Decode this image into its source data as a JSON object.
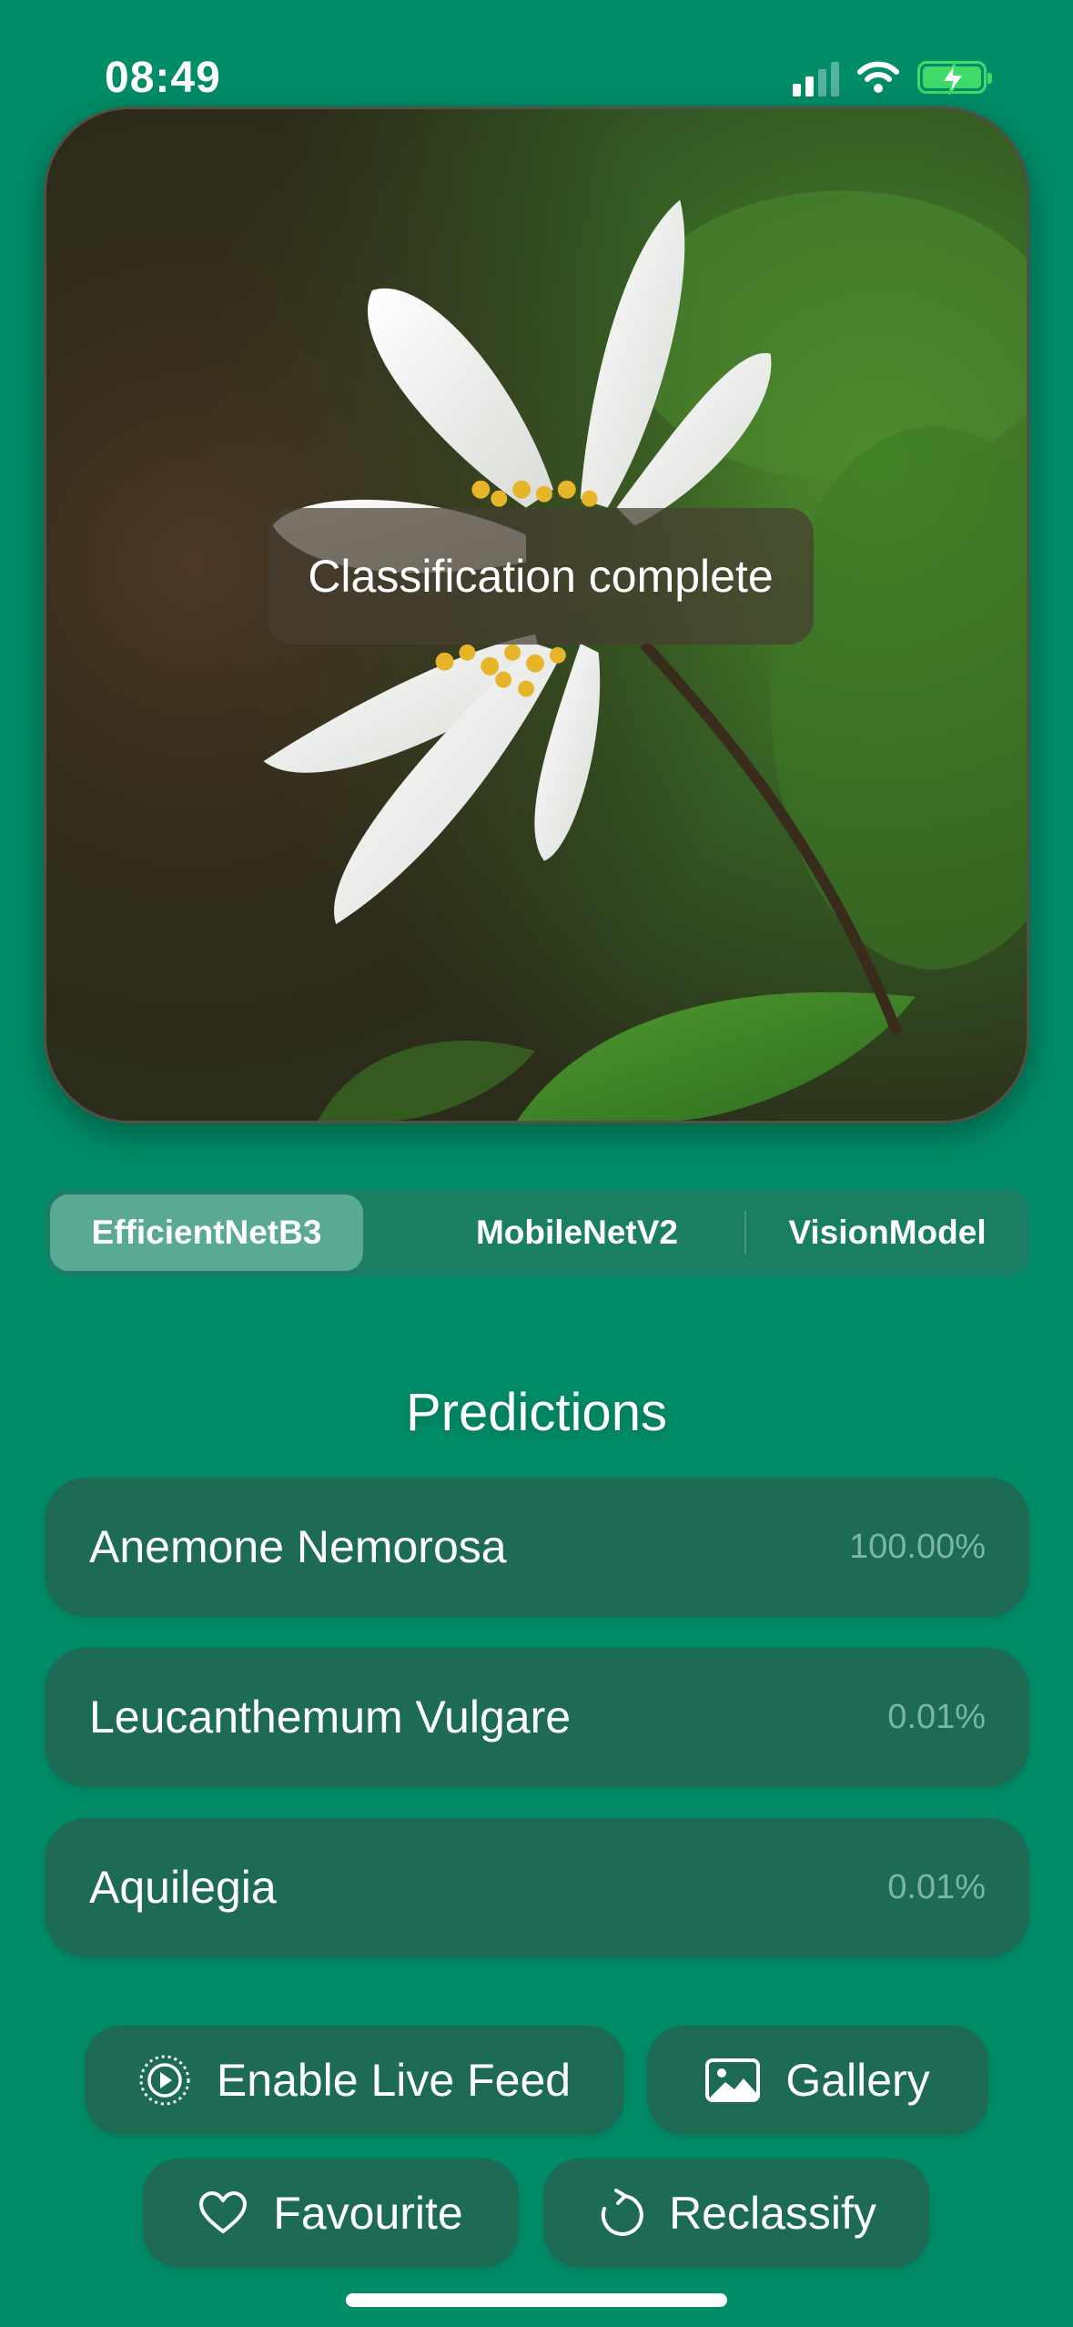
{
  "status_bar": {
    "time": "08:49"
  },
  "photo": {
    "toast": "Classification complete"
  },
  "models": {
    "tabs": [
      {
        "label": "EfficientNetB3"
      },
      {
        "label": "MobileNetV2"
      },
      {
        "label": "VisionModel"
      }
    ],
    "selected": "EfficientNetB3"
  },
  "predictions": {
    "title": "Predictions",
    "items": [
      {
        "name": "Anemone Nemorosa",
        "confidence": "100.00%"
      },
      {
        "name": "Leucanthemum Vulgare",
        "confidence": "0.01%"
      },
      {
        "name": "Aquilegia",
        "confidence": "0.01%"
      }
    ]
  },
  "actions": {
    "live_feed": "Enable Live Feed",
    "gallery": "Gallery",
    "favourite": "Favourite",
    "reclassify": "Reclassify"
  },
  "colors": {
    "background": "#008d68",
    "row": "#1d6a55",
    "segment_active": "#5aa995",
    "confidence_text": "#79b7a4",
    "battery": "#3fdc6a"
  },
  "icons": [
    "signal-icon",
    "wifi-icon",
    "battery-charging-icon",
    "play-circle-icon",
    "photo-icon",
    "heart-icon",
    "refresh-icon"
  ]
}
